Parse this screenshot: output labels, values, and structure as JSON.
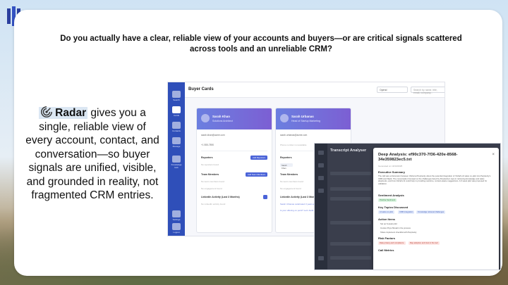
{
  "slide": {
    "headline": "Do you actually have a clear, reliable view of your accounts and buyers—or are critical signals scattered across tools and an unreliable CRM?",
    "brand_word": "Radar",
    "body_text": " gives you a single, reliable view of every account, contact, and conversation—so buyer signals are unified, visible, and grounded in reality, not fragmented CRM entries."
  },
  "buyer_cards": {
    "title": "Buyer Cards",
    "select_value": "Opend",
    "search_placeholder": "Search by name, title, email, company...",
    "sidebar_items": [
      "Search",
      "Cards",
      "Contacts",
      "Manage",
      "Knowledge Hub",
      "Settings",
      "Logout"
    ],
    "cards": [
      {
        "name": "Sarah Khan",
        "role": "Solutions Architect",
        "email": "sarah.khan@acme.com",
        "phone": "+1 555-7890",
        "reporters_label": "Reporters",
        "reporters_button": "Add Reporters",
        "reporters_note": "No reporters found",
        "team_label": "Team Members",
        "team_button": "Add Team Members",
        "team_note": "No team members found",
        "team_note2": "No engagement found",
        "linkedin_label": "LinkedIn Activity (Last 3 Months)",
        "linkedin_note": "No LinkedIn activity found"
      },
      {
        "name": "Sarah Urbanas",
        "role": "Head of Startup Marketing",
        "email": "sarah.urbanas@acme.com",
        "phone_note": "Phone number not available",
        "reporters_label": "Reporters",
        "reporters_chip": "Sarah Khan",
        "team_label": "Team Members",
        "team_note": "No team members found",
        "team_note2": "No engagement found",
        "linkedin_label": "LinkedIn Activity (Last 3 Months)",
        "linkedin_note": "Sarah Urbanas celebrated 3 years at...",
        "linkedin_note2": "Is your offering on point? Let's build..."
      }
    ]
  },
  "transcript": {
    "title": "Transcript Analyser",
    "modal": {
      "title": "Deep Analysis: ef90c370-7f36-420e-8568-34e359823ec5.txt",
      "close": "×",
      "meta": "Generated on 19/10/2025",
      "summary_label": "Executive Summary",
      "summary_text": "The call was a discussion between Vishal at Perplexity about the potential integration of Vishal's AI sales co-pilot into Perplexity's CRM and Slack. The conversation focused on the challenges faced by Perplexity's reps in retrieving knowledge and sales playbooks, and how Vishal's AI could help in providing real-time, context-aware suggestions. A 6 week pilot was proposed for validation.",
      "sentiment_label": "Sentiment Analysis",
      "sentiment_value": "Positive Sentiment",
      "topics_label": "Key Topics Discussed",
      "topics": [
        "AI sales co-pilot",
        "CRM integration",
        "Knowledge retrieval challenges"
      ],
      "actions_label": "Action Items",
      "actions": [
        "Set up 6-week pilot",
        "Involve Priya Shetal in the process",
        "Share implement checklist with Perplexity"
      ],
      "risk_label": "Risk Factors",
      "risks": [
        "Data privacy and compliance",
        "Rep adoption and trust in the tool"
      ],
      "call_metrics_label": "Call Metrics"
    }
  },
  "colors": {
    "card_accent": "#2f4fb9",
    "card_header_gradient_start": "#6b7fe0",
    "card_header_gradient_end": "#7c5fd3",
    "positive": "#2d7a3d",
    "risk": "#b53b2e"
  },
  "icons": [
    "radar-icon",
    "brand-logo-icon",
    "filter-icon",
    "close-icon"
  ]
}
